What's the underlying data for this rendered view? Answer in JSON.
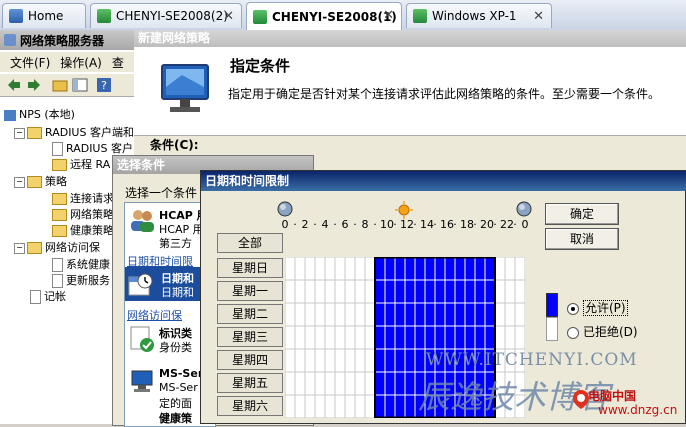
{
  "browser_tabs": [
    {
      "label": "Home",
      "active": false
    },
    {
      "label": "CHENYI-SE2008(2)",
      "active": false
    },
    {
      "label": "CHENYI-SE2008(1)",
      "active": true
    },
    {
      "label": "Windows XP-1",
      "active": false
    }
  ],
  "mmc": {
    "title": "网络策略服务器",
    "menu": [
      "文件(F)",
      "操作(A)",
      "查"
    ],
    "tree": [
      {
        "label": "NPS (本地)",
        "level": 0
      },
      {
        "label": "RADIUS 客户端和",
        "level": 1
      },
      {
        "label": "RADIUS 客户",
        "level": 2
      },
      {
        "label": "远程 RA",
        "level": 2
      },
      {
        "label": "策略",
        "level": 1
      },
      {
        "label": "连接请求",
        "level": 2
      },
      {
        "label": "网络策略",
        "level": 2
      },
      {
        "label": "健康策略",
        "level": 2
      },
      {
        "label": "网络访问保",
        "level": 1
      },
      {
        "label": "系统健康",
        "level": 2
      },
      {
        "label": "更新服务",
        "level": 2
      },
      {
        "label": "记帐",
        "level": 1
      }
    ]
  },
  "wizard": {
    "title": "新建网络策略",
    "heading": "指定条件",
    "description": "指定用于确定是否针对某个连接请求评估此网络策略的条件。至少需要一个条件。",
    "conditions_label": "条件(C):"
  },
  "select_dialog": {
    "title": "选择条件",
    "prompt": "选择一个条件",
    "list": [
      {
        "type": "item",
        "text1": "HCAP 用",
        "text2": "HCAP 用",
        "text3": "第三方"
      },
      {
        "type": "group",
        "text1": "日期和时间限"
      },
      {
        "type": "item",
        "text1": "日期和",
        "text2": "日期和",
        "selected": true
      },
      {
        "type": "group",
        "text1": "网络访问保"
      },
      {
        "type": "item",
        "text1": "标识类",
        "text2": "身份类"
      },
      {
        "type": "item",
        "text1": "MS-Ser",
        "text2": "MS-Ser",
        "text3": "定的面"
      },
      {
        "type": "item",
        "text1": "健康策"
      }
    ]
  },
  "datetime_dialog": {
    "title": "日期和时间限制",
    "ok_label": "确定",
    "cancel_label": "取消",
    "all_label": "全部",
    "days": [
      "星期日",
      "星期一",
      "星期二",
      "星期三",
      "星期四",
      "星期五",
      "星期六"
    ],
    "hour_labels": [
      "0",
      "·",
      "2",
      "·",
      "4",
      "·",
      "6",
      "·",
      "8",
      "·",
      "10",
      "·",
      "12",
      "·",
      "14",
      "·",
      "16",
      "·",
      "18",
      "·",
      "20",
      "·",
      "22",
      "·",
      "0"
    ],
    "permitted_label": "允许(P)",
    "denied_label": "已拒绝(D)",
    "permitted_color": "#0000ff",
    "denied_color": "#ffffff",
    "selected_radio": "permitted",
    "permitted_hours": {
      "from": 9,
      "to": 21
    },
    "permitted_days": [
      "星期日",
      "星期一",
      "星期二",
      "星期三",
      "星期四",
      "星期五",
      "星期六"
    ]
  },
  "watermark": {
    "url": "WWW.ITCHENYI.COM",
    "cn": "辰逸技术博客",
    "site": "电脑中国",
    "site_url": "www.dnzg.cn"
  }
}
